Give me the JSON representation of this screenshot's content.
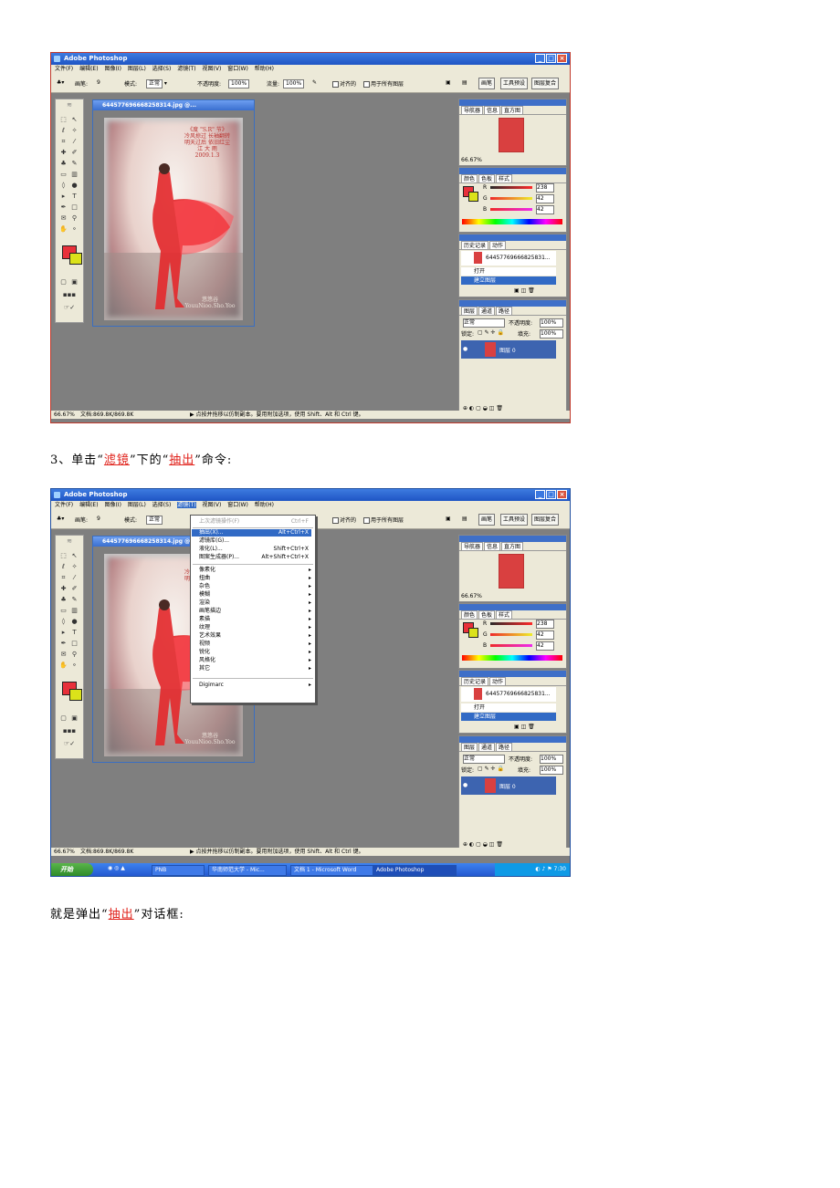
{
  "app": {
    "title": "Adobe Photoshop",
    "menus1": [
      "文件(F)",
      "编辑(E)",
      "图像(I)",
      "图层(L)",
      "选择(S)",
      "滤镜(T)",
      "视图(V)",
      "窗口(W)",
      "帮助(H)"
    ],
    "menus2": [
      "文件(F)",
      "编辑(E)",
      "图像(I)",
      "图层(L)",
      "选择(S)",
      "滤镜(T)",
      "视图(V)",
      "窗口(W)",
      "帮助(H)"
    ],
    "options": {
      "brush_label": "画笔:",
      "brush_size": "9",
      "mode_label": "模式:",
      "mode_value": "正常",
      "opacity_label": "不透明度:",
      "opacity_value": "100%",
      "flow_label": "流量:",
      "flow_value": "100%",
      "aligned_label": "对齐的",
      "all_layers_label": "用于所有图层",
      "tab_buttons": [
        "画笔",
        "工具预设",
        "图层复合"
      ]
    },
    "document_title": "644577696668258314.jpg @...",
    "photo_caption": [
      "《度 \"S.R\" 节》",
      "冷风掠过 长袖翻转",
      "明天过后 依旧红尘",
      "江 大 雨",
      "2009.1.3"
    ],
    "watermark": [
      "悠悠谷",
      "YouuNioo.Sho.Yoo"
    ],
    "navigator": {
      "tabs": [
        "导航器",
        "信息",
        "直方图"
      ],
      "zoom": "66.67%"
    },
    "color": {
      "tabs": [
        "颜色",
        "色板",
        "样式"
      ],
      "channels": [
        {
          "label": "R",
          "value": "238"
        },
        {
          "label": "G",
          "value": "42"
        },
        {
          "label": "B",
          "value": "42"
        }
      ]
    },
    "history": {
      "tabs": [
        "历史记录",
        "动作"
      ],
      "snapshot": "644577696668258​31...",
      "items": [
        "打开",
        "建立图层"
      ]
    },
    "layers": {
      "tabs": [
        "图层",
        "通道",
        "路径"
      ],
      "blend": "正常",
      "opacity_label": "不透明度:",
      "opacity": "100%",
      "lock_label": "锁定:",
      "fill_label": "填充:",
      "fill": "100%",
      "layer_name": "图层 0"
    },
    "status": {
      "zoom": "66.67%",
      "doc": "文档:869.8K/869.8K",
      "hint": "▶ 点按并拖移以仿制副本。要用附加选项，使用 Shift、Alt 和 Ctrl 键。"
    }
  },
  "filter_menu": {
    "last_filter": {
      "label": "上次滤镜操作(F)",
      "shortcut": "Ctrl+F"
    },
    "items_top": [
      {
        "label": "抽出(X)...",
        "shortcut": "Alt+Ctrl+X",
        "selected": true
      },
      {
        "label": "滤镜库(G)...",
        "shortcut": ""
      },
      {
        "label": "液化(L)...",
        "shortcut": "Shift+Ctrl+X"
      },
      {
        "label": "图案生成器(P)...",
        "shortcut": "Alt+Shift+Ctrl+X"
      }
    ],
    "submenus": [
      "像素化",
      "扭曲",
      "杂色",
      "模糊",
      "渲染",
      "画笔描边",
      "素描",
      "纹理",
      "艺术效果",
      "视频",
      "锐化",
      "风格化",
      "其它"
    ],
    "bottom": "Digimarc"
  },
  "taskbar": {
    "start": "开始",
    "items": [
      "PNB",
      "华南师范大学 - Mic...",
      "文档 1 - Microsoft Word",
      "Adobe Photoshop"
    ],
    "time": "7:30"
  },
  "text": {
    "step3_prefix": "3、单击“",
    "step3_filter": "滤镜",
    "step3_mid": "”下的“",
    "step3_extract": "抽出",
    "step3_suffix": "”命令:",
    "popup_prefix": "就是弹出“",
    "popup_extract": "抽出",
    "popup_suffix": "”对话框:"
  },
  "colors": {
    "foreground": "#e8303a",
    "background": "#dbe21a",
    "xp_blue": "#2458d0"
  }
}
